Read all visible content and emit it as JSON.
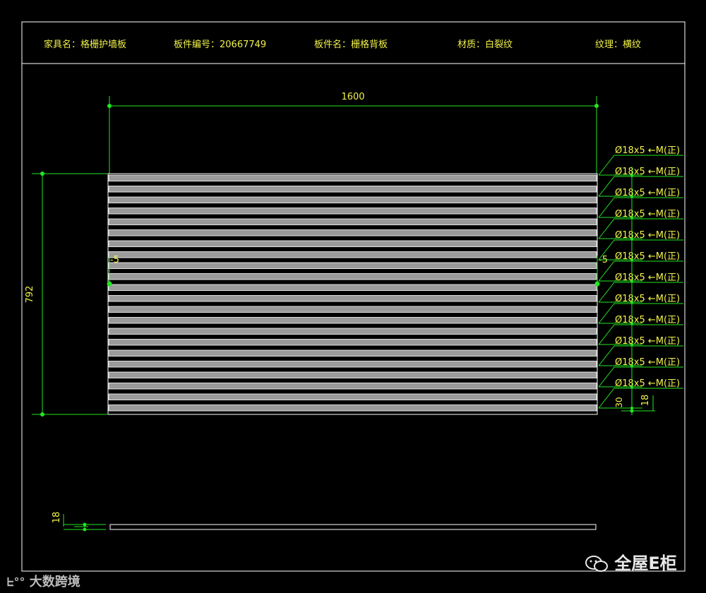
{
  "header": {
    "furniture_label": "家具名：格栅护墙板",
    "part_no_label": "板件编号：20667749",
    "part_name_label": "板件名：栅格背板",
    "material_label": "材质：白裂纹",
    "grain_label": "纹理：横纹"
  },
  "dimensions": {
    "width": "1600",
    "height": "792",
    "thickness": "18",
    "edge_offset_left": "-5",
    "edge_offset_right": "-5",
    "right_thickness": "18",
    "bottom_spacing": "30"
  },
  "hole_callout": "Ø18x5 ←M(正)",
  "hole_count": 12,
  "slat_count": 22,
  "colors": {
    "background": "#000000",
    "frame": "#ffffff",
    "dimension": "#22e622",
    "text": "#f2f24a"
  },
  "watermarks": {
    "brand_right": "全屋E柜",
    "brand_left": "大数跨境"
  }
}
